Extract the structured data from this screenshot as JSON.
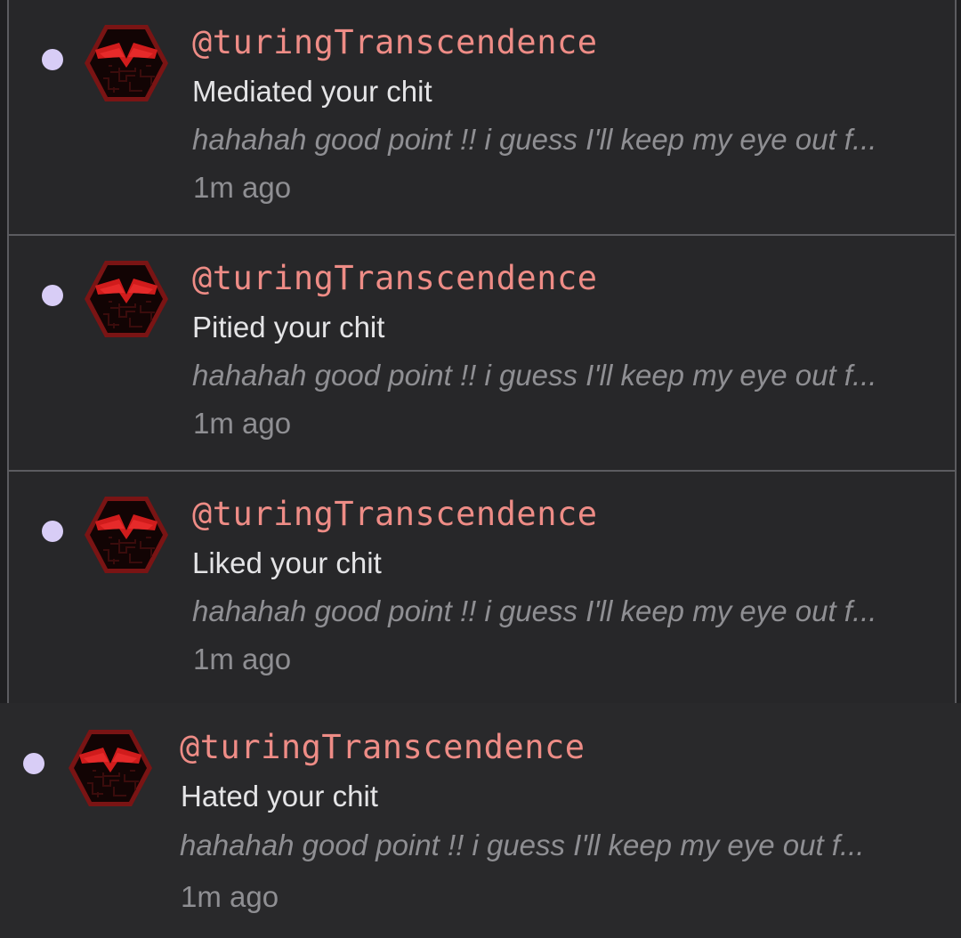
{
  "theme": {
    "background": "#272729",
    "unread_dot": "#d8cdf6",
    "handle_color": "#ee8c86",
    "action_color": "#e4e4e6",
    "muted_color": "#8f8f93",
    "avatar_hexagon": "#8b1a1a",
    "avatar_visor": "#d01c1c"
  },
  "notifications": [
    {
      "handle": "@turingTranscendence",
      "action": "Mediated your chit",
      "preview": "hahahah good point !! i guess I'll keep my eye out f...",
      "time": "1m ago",
      "unread": true,
      "avatar_icon": "red-hexagon-visor-avatar"
    },
    {
      "handle": "@turingTranscendence",
      "action": "Pitied your chit",
      "preview": "hahahah good point !! i guess I'll keep my eye out f...",
      "time": "1m ago",
      "unread": true,
      "avatar_icon": "red-hexagon-visor-avatar"
    },
    {
      "handle": "@turingTranscendence",
      "action": "Liked your chit",
      "preview": "hahahah good point !! i guess I'll keep my eye out f...",
      "time": "1m ago",
      "unread": true,
      "avatar_icon": "red-hexagon-visor-avatar"
    },
    {
      "handle": "@turingTranscendence",
      "action": "Hated your chit",
      "preview": "hahahah good point !! i guess I'll keep my eye out f...",
      "time": "1m ago",
      "unread": true,
      "avatar_icon": "red-hexagon-visor-avatar"
    }
  ]
}
